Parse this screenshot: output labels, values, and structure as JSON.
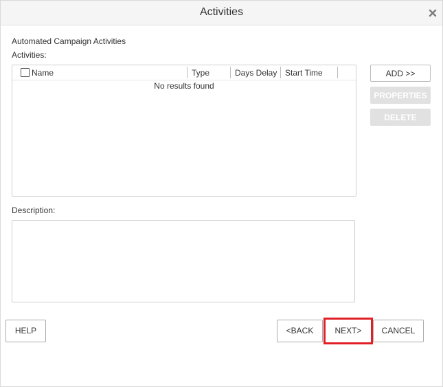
{
  "dialog": {
    "title": "Activities",
    "close_icon": "close-icon"
  },
  "section": {
    "heading": "Automated Campaign Activities",
    "activities_label": "Activities:"
  },
  "grid": {
    "columns": [
      "Name",
      "Type",
      "Days Delay",
      "Start Time"
    ],
    "empty_message": "No results found",
    "select_all_checked": false
  },
  "side_buttons": {
    "add": "ADD >>",
    "properties": "PROPERTIES",
    "delete": "DELETE"
  },
  "description": {
    "label": "Description:",
    "value": ""
  },
  "footer": {
    "help": "HELP",
    "back": "<BACK",
    "next": "NEXT>",
    "cancel": "CANCEL"
  },
  "colors": {
    "highlight": "#e01f26",
    "disabled_button": "#e1e1e1"
  }
}
